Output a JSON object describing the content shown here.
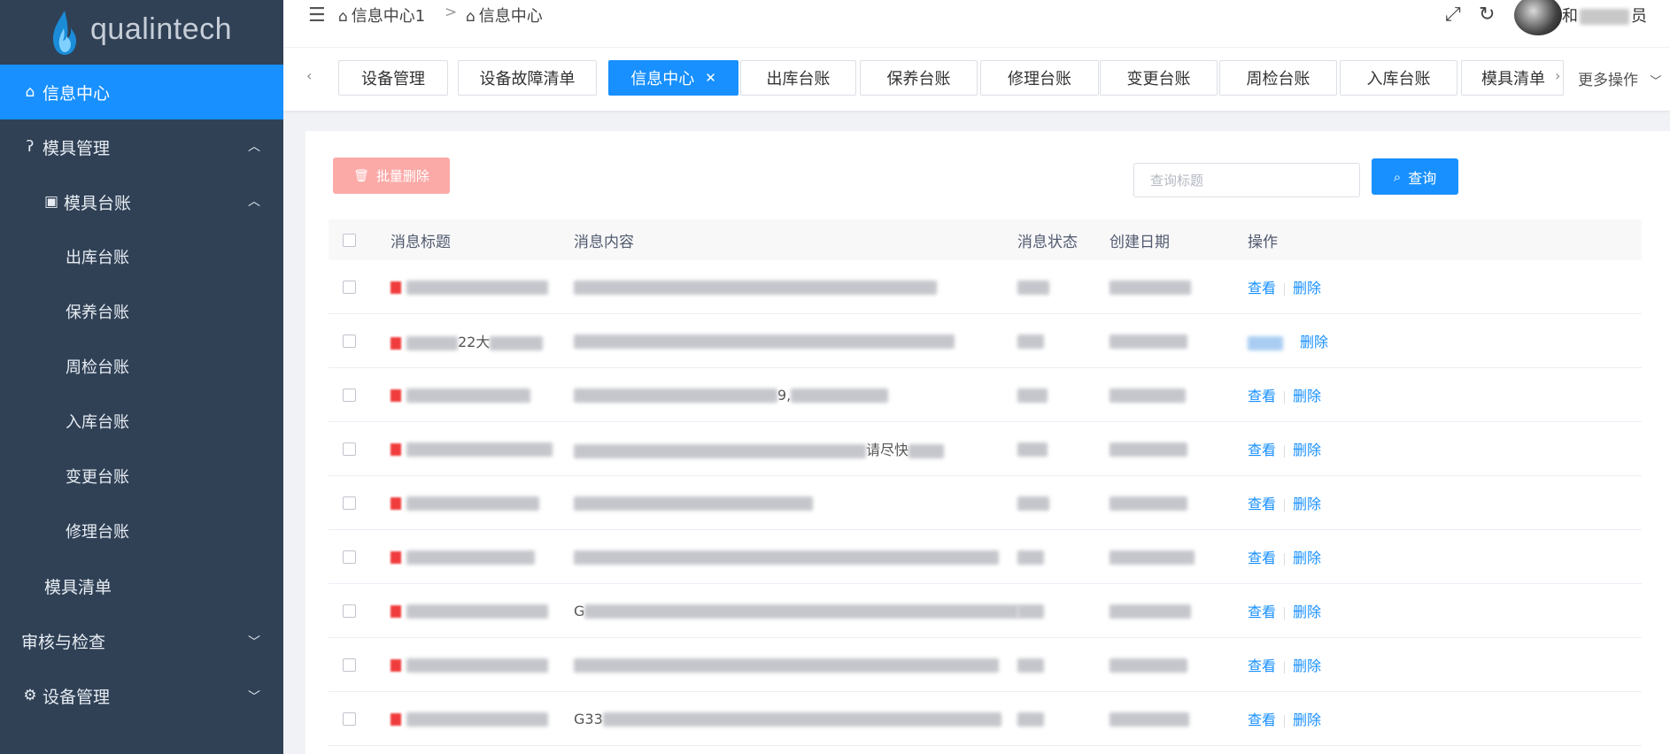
{
  "app": {
    "logo_text": "qualintech"
  },
  "sidebar": {
    "items": [
      {
        "label": "信息中心",
        "icon": "home-icon"
      },
      {
        "label": "模具管理",
        "icon": "ear-icon"
      },
      {
        "label": "模具台账",
        "icon": "contacts-icon"
      },
      {
        "label": "出库台账"
      },
      {
        "label": "保养台账"
      },
      {
        "label": "周检台账"
      },
      {
        "label": "入库台账"
      },
      {
        "label": "变更台账"
      },
      {
        "label": "修理台账"
      },
      {
        "label": "模具清单"
      },
      {
        "label": "审核与检查"
      },
      {
        "label": "设备管理",
        "icon": "gear-icon"
      }
    ]
  },
  "header": {
    "breadcrumb": [
      "信息中心1",
      "信息中心"
    ],
    "breadcrumb_separator": ">",
    "username_prefix": "和",
    "username_suffix": "员"
  },
  "tabs": {
    "items": [
      "设备管理",
      "设备故障清单",
      "信息中心",
      "出库台账",
      "保养台账",
      "修理台账",
      "变更台账",
      "周检台账",
      "入库台账",
      "模具清单"
    ],
    "active_index": 2,
    "more_label": "更多操作"
  },
  "toolbar": {
    "batch_delete_label": "批量删除",
    "search_placeholder": "查询标题",
    "search_button_label": "查询"
  },
  "table": {
    "columns": [
      "消息标题",
      "消息内容",
      "消息状态",
      "创建日期",
      "操作"
    ],
    "view_label": "查看",
    "delete_label": "删除",
    "rows": [
      {
        "title_visible": "",
        "content_visible": ""
      },
      {
        "title_visible": "22大",
        "content_visible": ""
      },
      {
        "title_visible": "",
        "content_visible": "9,"
      },
      {
        "title_visible": "",
        "content_visible": "请尽快"
      },
      {
        "title_visible": "",
        "content_visible": ""
      },
      {
        "title_visible": "",
        "content_visible": ""
      },
      {
        "title_visible": "",
        "content_visible": "G"
      },
      {
        "title_visible": "",
        "content_visible": ""
      },
      {
        "title_visible": "",
        "content_visible": "G33"
      }
    ]
  },
  "colors": {
    "sidebar_bg": "#304156",
    "accent": "#1890ff",
    "danger_disabled": "#fbaaa8"
  }
}
